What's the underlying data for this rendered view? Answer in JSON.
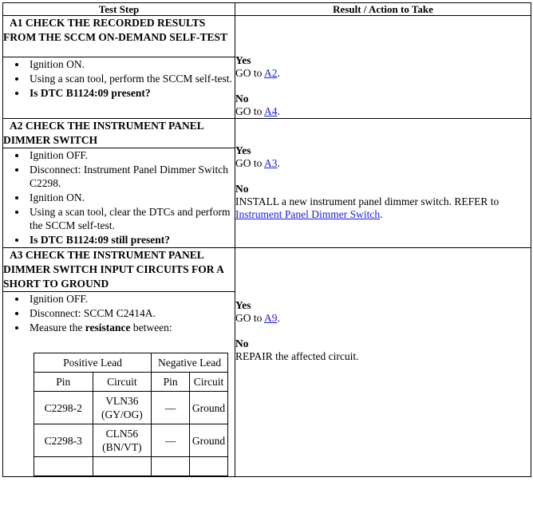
{
  "table": {
    "columns": [
      {
        "label": "Test Step"
      },
      {
        "label": "Result / Action to Take"
      }
    ],
    "sections": [
      {
        "id": "A1",
        "title": "A1 CHECK THE RECORDED RESULTS FROM THE SCCM ON-DEMAND SELF-TEST",
        "steps": [
          {
            "text": "Ignition ON.",
            "bold": false
          },
          {
            "text": "Using a scan tool, perform the SCCM self-test.",
            "bold": false
          },
          {
            "text": "Is DTC B1124:09 present?",
            "bold": true
          }
        ],
        "result": {
          "yes_label": "Yes",
          "yes_prefix": "GO to",
          "yes_link": "A2",
          "yes_suffix": ".",
          "no_label": "No",
          "no_prefix": "GO to",
          "no_link": "A4",
          "no_suffix": "."
        }
      },
      {
        "id": "A2",
        "title": "A2 CHECK THE INSTRUMENT PANEL DIMMER SWITCH",
        "steps": [
          {
            "text": "Ignition OFF.",
            "bold": false
          },
          {
            "text": "Disconnect: Instrument Panel Dimmer Switch C2298.",
            "bold": false
          },
          {
            "text": "Ignition ON.",
            "bold": false
          },
          {
            "text": "Using a scan tool, clear the DTCs and perform the SCCM self-test.",
            "bold": false
          },
          {
            "text": "Is DTC B1124:09 still present?",
            "bold": true
          }
        ],
        "result": {
          "yes_label": "Yes",
          "yes_prefix": "GO to",
          "yes_link": "A3",
          "yes_suffix": ".",
          "no_label": "No",
          "no_prefix": "INSTALL a new instrument panel dimmer switch. REFER to",
          "no_link": "Instrument Panel Dimmer Switch",
          "no_suffix": "."
        }
      },
      {
        "id": "A3",
        "title": "A3 CHECK THE INSTRUMENT PANEL DIMMER SWITCH INPUT CIRCUITS FOR A SHORT TO GROUND",
        "steps": [
          {
            "text": "Ignition OFF.",
            "bold": false
          },
          {
            "text": "Disconnect: SCCM C2414A.",
            "bold": false
          },
          {
            "text": "Measure the resistance between:",
            "bold": false,
            "emphasis": "resistance"
          }
        ],
        "measurement_table": {
          "group_headers": [
            "Positive Lead",
            "Negative Lead"
          ],
          "sub_headers": [
            "Pin",
            "Circuit",
            "Pin",
            "Circuit"
          ],
          "rows": [
            {
              "pos_pin": "C2298-2",
              "pos_circuit": "VLN36 (GY/OG)",
              "neg_pin": "—",
              "neg_circuit": "Ground"
            },
            {
              "pos_pin": "C2298-3",
              "pos_circuit": "CLN56 (BN/VT)",
              "neg_pin": "—",
              "neg_circuit": "Ground"
            }
          ]
        },
        "result": {
          "yes_label": "Yes",
          "yes_prefix": "GO to",
          "yes_link": "A9",
          "yes_suffix": ".",
          "no_label": "No",
          "no_prefix": "REPAIR the affected circuit.",
          "no_link": "",
          "no_suffix": ""
        }
      }
    ]
  },
  "colors": {
    "link": "#1a1ae6",
    "border": "#000000",
    "text": "#000000",
    "background": "#ffffff"
  }
}
